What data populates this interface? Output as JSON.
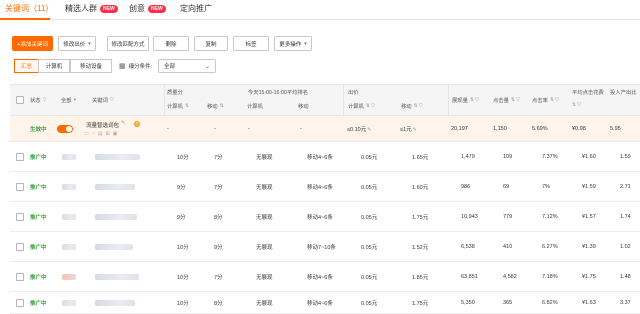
{
  "tabs": [
    {
      "label": "关键词（11）",
      "active": true,
      "badge": ""
    },
    {
      "label": "精选人群",
      "active": false,
      "badge": "NEW"
    },
    {
      "label": "创意",
      "active": false,
      "badge": "NEW"
    },
    {
      "label": "定向推广",
      "active": false,
      "badge": ""
    }
  ],
  "toolbar": {
    "add_keyword": "+添加关键词",
    "modify_bid": "修改出价",
    "modify_match": "修改匹配方式",
    "delete": "删除",
    "copy": "复制",
    "tag": "标签",
    "more": "更多操作"
  },
  "segments": {
    "summary": "汇总",
    "computer": "计算机",
    "mobile": "移动设备"
  },
  "filter": {
    "label": "细分条件:",
    "value": "全部"
  },
  "headers": {
    "status": "状态",
    "all": "全部",
    "keyword": "关键词",
    "quality_score": "质量分",
    "qs_computer": "计算机",
    "qs_mobile": "移动",
    "rank_group": "今天15:00-16:00平均排名",
    "rank_computer": "计算机",
    "rank_mobile": "移动",
    "bid_group": "出价",
    "bid_computer": "计算机",
    "bid_mobile": "移动",
    "impressions": "展现量",
    "clicks": "点击量",
    "ctr": "点击率",
    "avg_cpc": "平均点击花费",
    "roi": "投入产出比"
  },
  "rows": [
    {
      "status": "生效中",
      "keyword": "流量智选词包",
      "qs_pc": "-",
      "qs_mobile": "-",
      "rank_pc": "-",
      "rank_mobile": "-",
      "bid_pc": "≤0.10元",
      "bid_mobile": "≤1元",
      "impressions": "20,197",
      "clicks": "1,150",
      "ctr": "5.69%",
      "cpc": "¥0.98",
      "roi": "5.95"
    },
    {
      "status": "推广中",
      "keyword": "",
      "qs_pc": "10分",
      "qs_mobile": "7分",
      "rank_pc": "无展现",
      "rank_mobile": "移动4~6条",
      "bid_pc": "0.05元",
      "bid_mobile": "1.65元",
      "impressions": "1,479",
      "clicks": "109",
      "ctr": "7.37%",
      "cpc": "¥1.60",
      "roi": "1.59"
    },
    {
      "status": "推广中",
      "keyword": "",
      "qs_pc": "9分",
      "qs_mobile": "7分",
      "rank_pc": "无展现",
      "rank_mobile": "移动4~6条",
      "bid_pc": "0.05元",
      "bid_mobile": "1.60元",
      "impressions": "986",
      "clicks": "69",
      "ctr": "7%",
      "cpc": "¥1.59",
      "roi": "2.71"
    },
    {
      "status": "推广中",
      "keyword": "",
      "qs_pc": "9分",
      "qs_mobile": "8分",
      "rank_pc": "无展现",
      "rank_mobile": "移动4~6条",
      "bid_pc": "0.05元",
      "bid_mobile": "1.75元",
      "impressions": "10,943",
      "clicks": "779",
      "ctr": "7.12%",
      "cpc": "¥1.57",
      "roi": "1.74"
    },
    {
      "status": "推广中",
      "keyword": "",
      "qs_pc": "10分",
      "qs_mobile": "9分",
      "rank_pc": "无展现",
      "rank_mobile": "移动7~10条",
      "bid_pc": "0.05元",
      "bid_mobile": "1.52元",
      "impressions": "6,538",
      "clicks": "410",
      "ctr": "6.27%",
      "cpc": "¥1.39",
      "roi": "1.02"
    },
    {
      "status": "推广中",
      "keyword": "",
      "qs_pc": "10分",
      "qs_mobile": "7分",
      "rank_pc": "无展现",
      "rank_mobile": "移动4~6条",
      "bid_pc": "0.05元",
      "bid_mobile": "1.85元",
      "impressions": "63,851",
      "clicks": "4,582",
      "ctr": "7.18%",
      "cpc": "¥1.75",
      "roi": "1.48"
    },
    {
      "status": "推广中",
      "keyword": "",
      "qs_pc": "10分",
      "qs_mobile": "8分",
      "rank_pc": "无展现",
      "rank_mobile": "移动4~6条",
      "bid_pc": "0.05元",
      "bid_mobile": "1.75元",
      "impressions": "5,350",
      "clicks": "365",
      "ctr": "6.82%",
      "cpc": "¥1.63",
      "roi": "3.37"
    }
  ]
}
